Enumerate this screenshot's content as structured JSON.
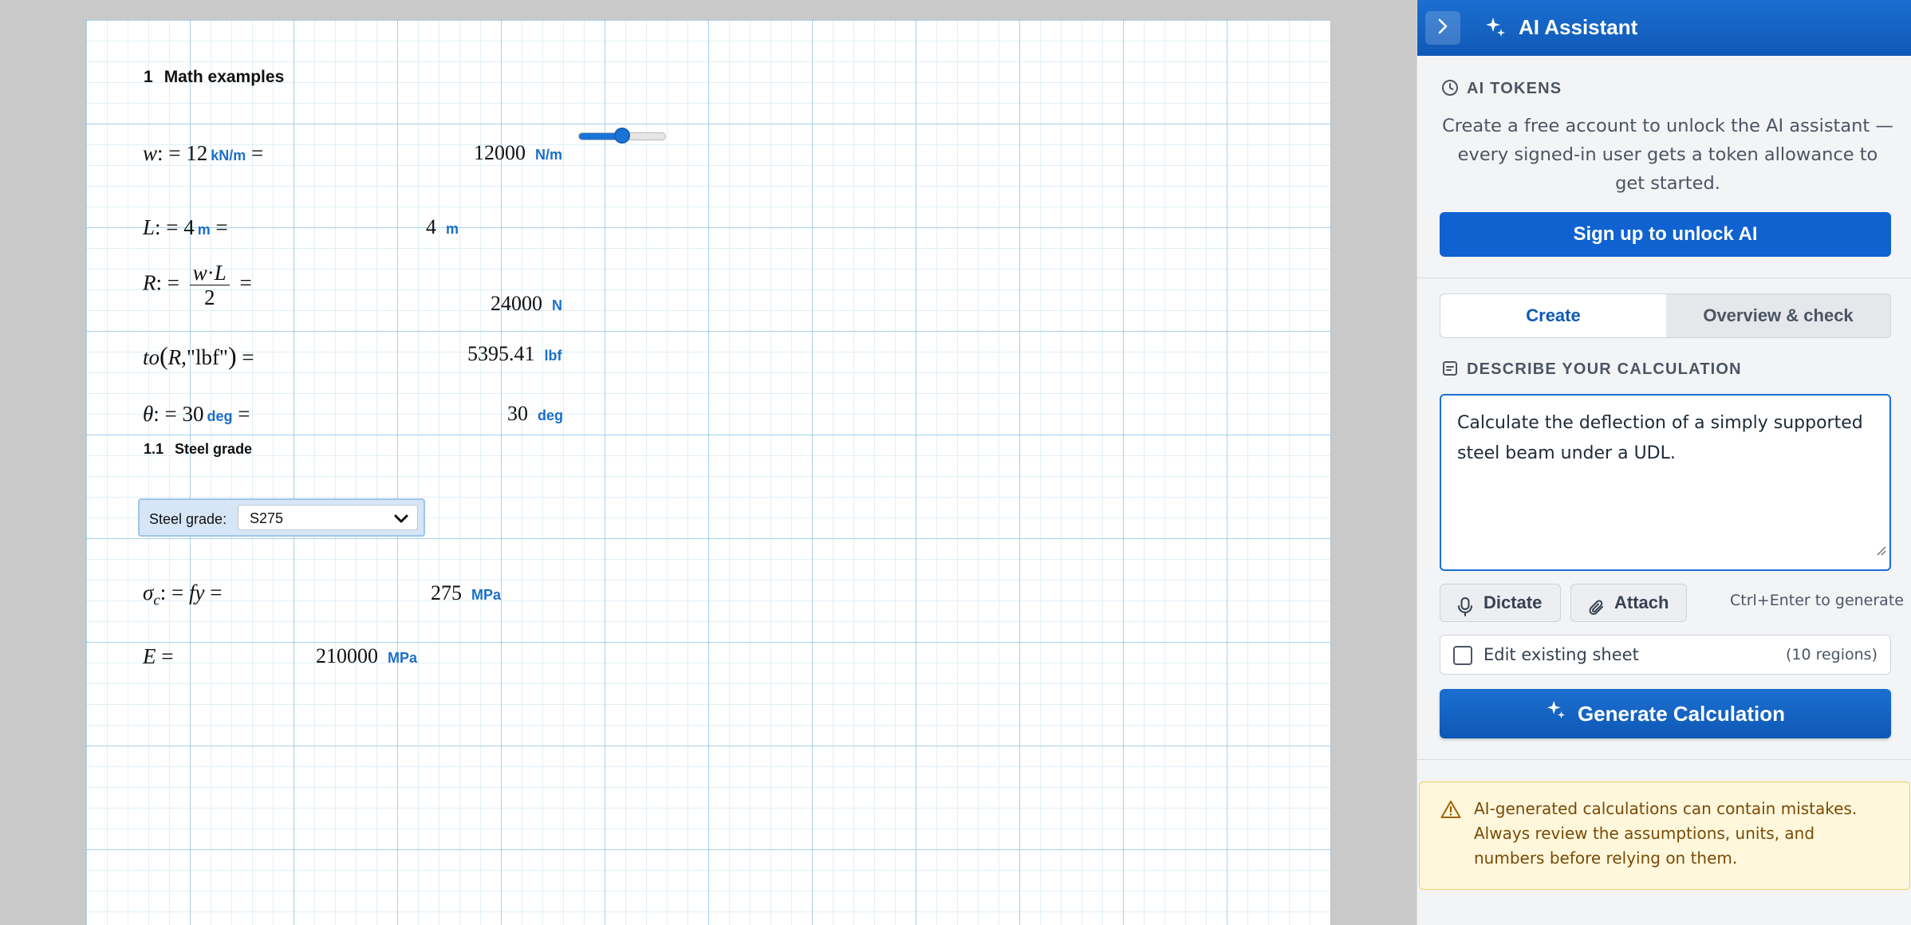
{
  "sheet": {
    "heading1": {
      "number": "1",
      "text": "Math examples"
    },
    "rows": {
      "w": {
        "lhs_var": "w",
        "assign": ": = 12",
        "unit": "kN/m",
        "eq": "=",
        "result": "12000",
        "result_unit": "N/m"
      },
      "L": {
        "lhs_var": "L",
        "assign": ": = 4",
        "unit": "m",
        "eq": "=",
        "result": "4",
        "result_unit": "m"
      },
      "R": {
        "lhs_var": "R",
        "assign": ": =",
        "num_a": "w",
        "num_dot": "·",
        "num_b": "L",
        "den": "2",
        "eq": "=",
        "result": "24000",
        "result_unit": "N"
      },
      "to": {
        "func": "to",
        "open": "(",
        "arg": "R",
        "arg2": ",\"lbf\"",
        "close": ")",
        "eq": "=",
        "result": "5395.41",
        "result_unit": "lbf"
      },
      "theta": {
        "lhs_var": "θ",
        "assign": ": = 30",
        "unit": "deg",
        "eq": "=",
        "result": "30",
        "result_unit": "deg"
      },
      "sigma": {
        "lhs_var": "σ",
        "sub": "c",
        "assign": ": =",
        "rhs": "fy",
        "eq": "=",
        "result": "275",
        "result_unit": "MPa"
      },
      "E": {
        "lhs_var": "E",
        "eq": "=",
        "result": "210000",
        "result_unit": "MPa"
      }
    },
    "slider": {
      "value_fraction": 0.5
    },
    "heading2": {
      "number": "1.1",
      "text": "Steel grade"
    },
    "steel_grade": {
      "label": "Steel grade:",
      "selected": "S275"
    }
  },
  "panel": {
    "title": "AI Assistant",
    "tokens_label": "AI TOKENS",
    "tokens_text": "Create a free account to unlock the AI assistant — every signed-in user gets a token allowance to get started.",
    "signup_button": "Sign up to unlock AI",
    "tabs": [
      {
        "label": "Create",
        "active": true
      },
      {
        "label": "Overview & check",
        "active": false
      }
    ],
    "describe_label": "DESCRIBE YOUR CALCULATION",
    "prompt_value": "Calculate the deflection of a simply supported steel beam under a UDL.",
    "dictate_label": "Dictate",
    "attach_label": "Attach",
    "shortcut_hint": "Ctrl+Enter to generate",
    "edit_existing_label": "Edit existing sheet",
    "regions_count": "(10 regions)",
    "generate_button": "Generate Calculation",
    "warning_text": "AI-generated calculations can contain mistakes. Always review the assumptions, units, and numbers before relying on them."
  },
  "colors": {
    "accent": "#0f62d0",
    "header": "#1b6fd0",
    "unit_blue": "#1a6fc9",
    "warning_bg": "#fef7dc",
    "warning_text": "#7a4a06"
  },
  "icons": {
    "collapse": "chevron-right-icon",
    "header": "sparkle-icon",
    "tokens": "clock-icon",
    "describe": "document-icon",
    "dictate": "microphone-icon",
    "attach": "paperclip-icon",
    "warning": "warning-triangle-icon"
  }
}
